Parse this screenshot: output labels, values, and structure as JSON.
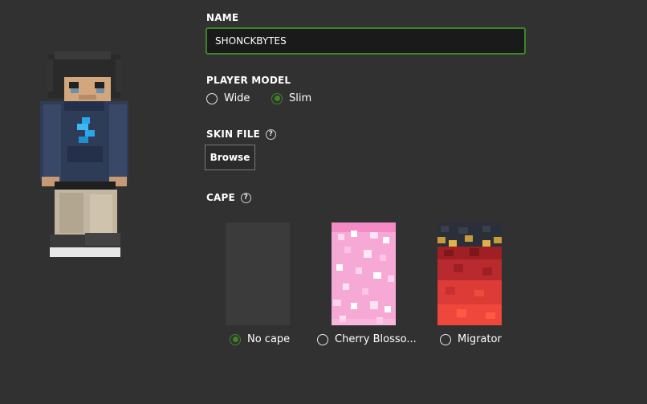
{
  "form": {
    "name_label": "NAME",
    "name_value": "SHONCKBYTES",
    "player_model_label": "PLAYER MODEL",
    "model_options": [
      {
        "label": "Wide",
        "selected": false
      },
      {
        "label": "Slim",
        "selected": true
      }
    ],
    "skin_file_label": "SKIN FILE",
    "help_glyph": "?",
    "browse_label": "Browse",
    "cape_label": "CAPE",
    "cape_options": [
      {
        "label": "No cape",
        "selected": true
      },
      {
        "label": "Cherry Blosso...",
        "selected": false
      },
      {
        "label": "Migrator",
        "selected": false
      }
    ]
  },
  "colors": {
    "background": "#313131",
    "accent_green": "#3c8527",
    "input_background": "#1a1a1a"
  },
  "icons": {
    "help": "help-circle-icon",
    "radio": "radio-icon"
  }
}
